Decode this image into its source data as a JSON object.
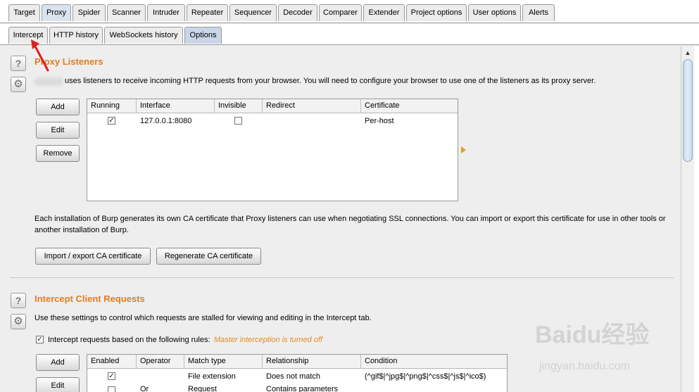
{
  "main_tabs": [
    "Target",
    "Proxy",
    "Spider",
    "Scanner",
    "Intruder",
    "Repeater",
    "Sequencer",
    "Decoder",
    "Comparer",
    "Extender",
    "Project options",
    "User options",
    "Alerts"
  ],
  "active_main_tab": "Proxy",
  "sub_tabs": [
    "Intercept",
    "HTTP history",
    "WebSockets history",
    "Options"
  ],
  "active_sub_tab": "Options",
  "listeners": {
    "title": "Proxy Listeners",
    "description": "uses listeners to receive incoming HTTP requests from your browser. You will need to configure your browser to use one of the listeners as its proxy server.",
    "buttons": {
      "add": "Add",
      "edit": "Edit",
      "remove": "Remove"
    },
    "columns": [
      "Running",
      "Interface",
      "Invisible",
      "Redirect",
      "Certificate"
    ],
    "rows": [
      {
        "running": true,
        "interface": "127.0.0.1:8080",
        "invisible": false,
        "redirect": "",
        "certificate": "Per-host"
      }
    ],
    "ca_text_line1": "Each installation of Burp generates its own CA certificate that Proxy listeners can use when negotiating SSL connections. You can import or export this certificate for use in other tools or",
    "ca_text_line2": "another installation of Burp.",
    "import_export_label": "Import / export CA certificate",
    "regenerate_label": "Regenerate CA certificate"
  },
  "intercept": {
    "title": "Intercept Client Requests",
    "description": "Use these settings to control which requests are stalled for viewing and editing in the Intercept tab.",
    "rules_checkbox_label": "Intercept requests based on the following rules:",
    "rules_checked": true,
    "master_status": "Master interception is turned off",
    "buttons": {
      "add": "Add",
      "edit": "Edit"
    },
    "columns": [
      "Enabled",
      "Operator",
      "Match type",
      "Relationship",
      "Condition"
    ],
    "rows": [
      {
        "enabled": true,
        "operator": "",
        "match_type": "File extension",
        "relationship": "Does not match",
        "condition": "(^gif$|^jpg$|^png$|^css$|^js$|^ico$)"
      },
      {
        "enabled": false,
        "operator": "Or",
        "match_type": "Request",
        "relationship": "Contains parameters",
        "condition": ""
      }
    ]
  },
  "icons": {
    "help": "?",
    "settings": "⚙"
  },
  "colors": {
    "section_title": "#e37d1f",
    "active_tab": "#d9e3ef",
    "arrow": "#e02020"
  },
  "watermark": {
    "main": "Baidu经验",
    "sub": "jingyan.baidu.com"
  }
}
